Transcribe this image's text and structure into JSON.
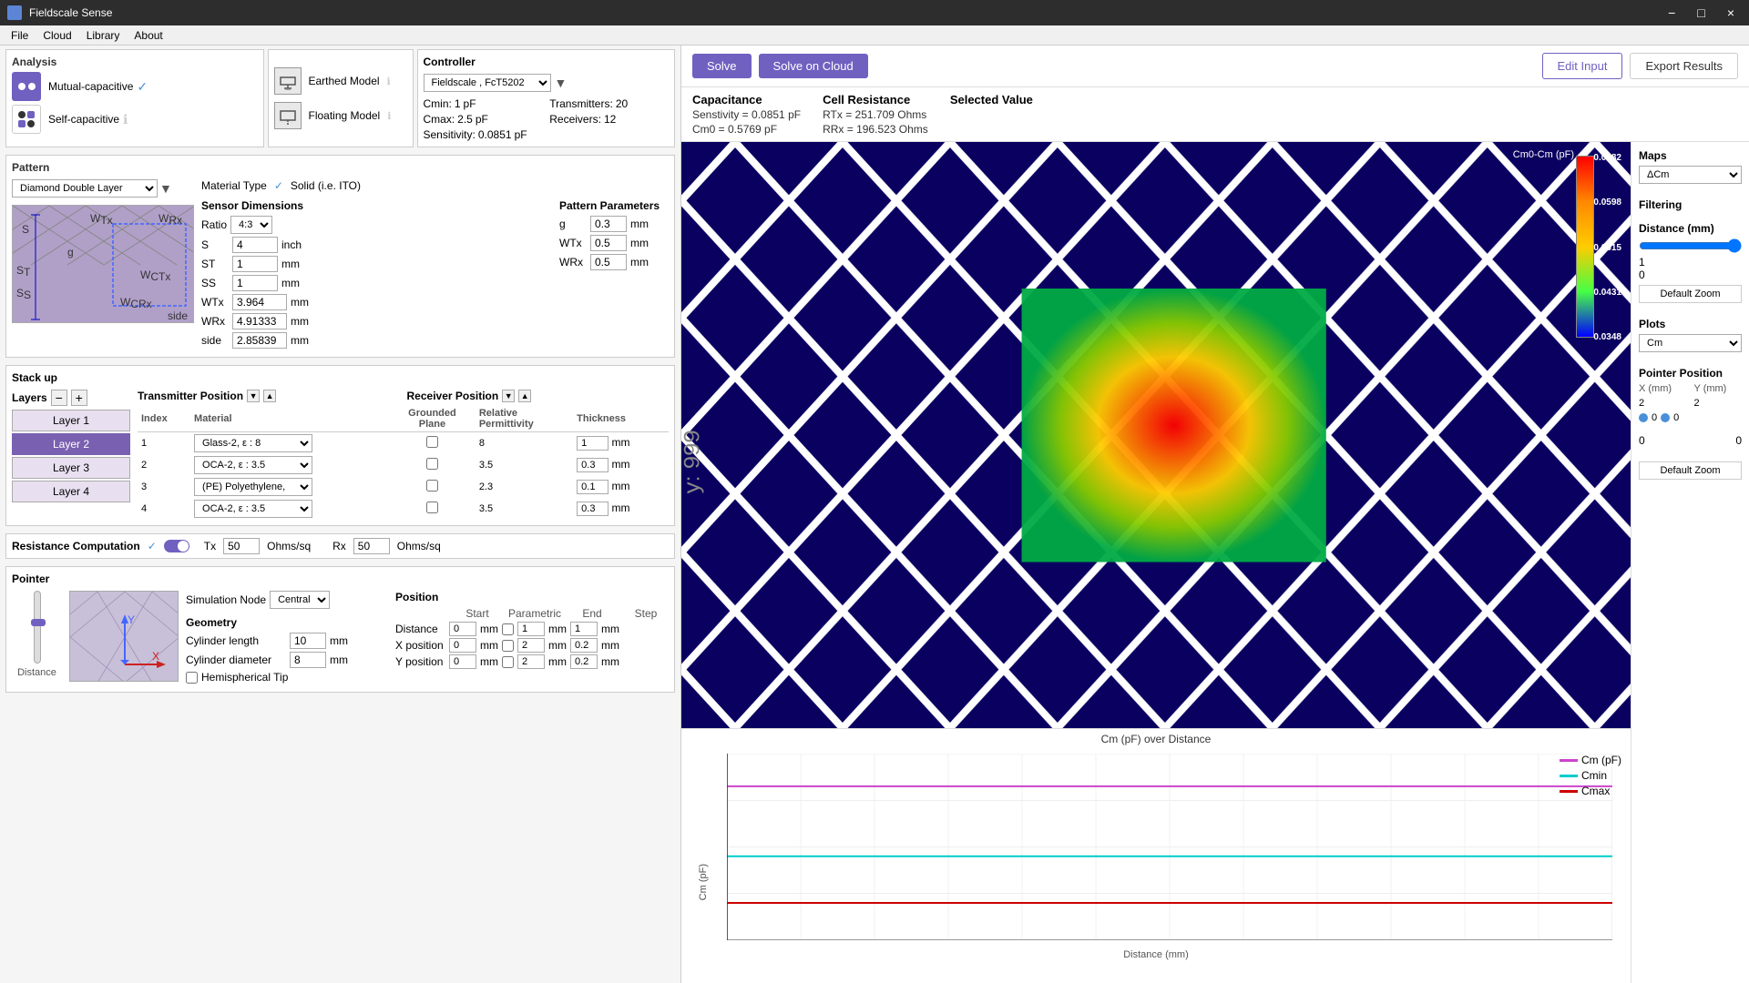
{
  "titleBar": {
    "appName": "Fieldscale Sense",
    "btnMinimize": "−",
    "btnMaximize": "□",
    "btnClose": "×"
  },
  "menuBar": {
    "items": [
      "File",
      "Cloud",
      "Library",
      "About"
    ]
  },
  "toolbar": {
    "solveLabel": "Solve",
    "solveCloudLabel": "Solve on Cloud",
    "editInputLabel": "Edit Input",
    "exportResultsLabel": "Export Results"
  },
  "infoBar": {
    "capacitanceTitle": "Capacitance",
    "capacitanceLine1": "Senstivity = 0.0851 pF",
    "capacitanceLine2": "Cm0 = 0.5769 pF",
    "cellResistanceTitle": "Cell Resistance",
    "cellResLine1": "RTx = 251.709 Ohms",
    "cellResLine2": "RRx = 196.523 Ohms",
    "selectedValueTitle": "Selected Value"
  },
  "analysis": {
    "title": "Analysis",
    "mutualCapLabel": "Mutual-capacitive",
    "selfCapLabel": "Self-capacitive",
    "earthedModelLabel": "Earthed Model",
    "floatingModelLabel": "Floating Model"
  },
  "controller": {
    "title": "Controller",
    "dropdown": "Fieldscale , FcT5202",
    "cminLabel": "Cmin:",
    "cminValue": "1",
    "cminUnit": "pF",
    "cmaxLabel": "Cmax:",
    "cmaxValue": "2.5",
    "cmaxUnit": "pF",
    "sensitivityLabel": "Sensitivity:",
    "sensitivityValue": "0.0851",
    "sensitivityUnit": "pF",
    "transmittersLabel": "Transmitters:",
    "transmittersValue": "20",
    "receiversLabel": "Receivers:",
    "receiversValue": "12"
  },
  "pattern": {
    "title": "Pattern",
    "dropdown": "Diamond Double Layer",
    "materialTypeLabel": "Material Type",
    "solidLabel": "Solid (i.e. ITO)",
    "sensorDimensionsTitle": "Sensor Dimensions",
    "ratioLabel": "Ratio",
    "ratioValue": "4:3",
    "sLabel": "S",
    "sValue": "4",
    "sUnit": "inch",
    "stLabel": "ST",
    "stValue": "1",
    "stUnit": "mm",
    "ssLabel": "SS",
    "ssValue": "1",
    "ssUnit": "mm",
    "wtxLabel": "WTx",
    "wtxValue": "3.964",
    "wtxUnit": "mm",
    "wrxLabel": "WRx",
    "wrxValue": "4.91333",
    "wrxUnit": "mm",
    "sideLabel": "side",
    "sideValue": "2.85839",
    "sideUnit": "mm",
    "patternParamsTitle": "Pattern Parameters",
    "gLabel": "g",
    "gValue": "0.3",
    "gUnit": "mm",
    "wtxParamLabel": "WTx",
    "wtxParamValue": "0.5",
    "wtxParamUnit": "mm",
    "wrxParamLabel": "WRx",
    "wrxParamValue": "0.5",
    "wrxParamUnit": "mm"
  },
  "stackup": {
    "title": "Stack up",
    "layersLabel": "Layers",
    "layers": [
      {
        "name": "Layer 1",
        "selected": false
      },
      {
        "name": "Layer 2",
        "selected": true
      },
      {
        "name": "Layer 3",
        "selected": false
      },
      {
        "name": "Layer 4",
        "selected": false
      }
    ],
    "transmitterPositionLabel": "Transmitter Position",
    "receiverPositionLabel": "Receiver Position",
    "groundedPlaneLabel": "Grounded Plane",
    "columns": [
      "Index",
      "Material",
      "Grounded Plane",
      "Relative Permittivity",
      "Thickness"
    ],
    "rows": [
      {
        "index": "1",
        "material": "Glass-2,  ε : 8",
        "groundedPlane": false,
        "permittivity": "8",
        "thickness": "1",
        "thicknessUnit": "mm"
      },
      {
        "index": "2",
        "material": "OCA-2,  ε : 3.5",
        "groundedPlane": false,
        "permittivity": "3.5",
        "thickness": "0.3",
        "thicknessUnit": "mm"
      },
      {
        "index": "3",
        "material": "(PE) Polyethylene,",
        "groundedPlane": false,
        "permittivity": "2.3",
        "thickness": "0.1",
        "thicknessUnit": "mm"
      },
      {
        "index": "4",
        "material": "OCA-2,  ε : 3.5",
        "groundedPlane": false,
        "permittivity": "3.5",
        "thickness": "0.3",
        "thicknessUnit": "mm"
      }
    ]
  },
  "resistance": {
    "title": "Resistance Computation",
    "enabled": true,
    "txLabel": "Tx",
    "txValue": "50",
    "txUnit": "Ohms/sq",
    "rxLabel": "Rx",
    "rxValue": "50",
    "rxUnit": "Ohms/sq"
  },
  "pointer": {
    "title": "Pointer",
    "simulationNodeLabel": "Simulation Node",
    "simulationNodeValue": "Central",
    "distanceLabel": "Distance",
    "geometry": {
      "title": "Geometry",
      "cylinderLengthLabel": "Cylinder length",
      "cylinderLengthValue": "10",
      "cylinderLengthUnit": "mm",
      "cylinderDiameterLabel": "Cylinder diameter",
      "cylinderDiameterValue": "8",
      "cylinderDiameterUnit": "mm",
      "hemisphericalTipLabel": "Hemispherical Tip"
    },
    "position": {
      "title": "Position",
      "headers": [
        "Start",
        "Parametric",
        "End",
        "Step"
      ],
      "distanceRow": {
        "label": "Distance",
        "start": "0",
        "startUnit": "mm",
        "end": "1",
        "endUnit": "mm",
        "step": "1",
        "stepUnit": "mm"
      },
      "xPosRow": {
        "label": "X position",
        "start": "0",
        "startUnit": "mm",
        "end": "2",
        "endUnit": "mm",
        "step": "0.2",
        "stepUnit": "mm"
      },
      "yPosRow": {
        "label": "Y position",
        "start": "0",
        "startUnit": "mm",
        "end": "2",
        "endUnit": "mm",
        "step": "0.2",
        "stepUnit": "mm"
      }
    }
  },
  "visualization": {
    "mapTitle": "ΔCm",
    "filteringLabel": "Filtering",
    "distanceLabel": "Distance (mm)",
    "distanceValue": "1",
    "distanceMin": "0",
    "colorScaleMax": "0.0682",
    "colorScaleVal1": "0.0598",
    "colorScaleVal2": "0.0515",
    "colorScaleVal3": "0.0431",
    "colorScaleVal4": "0.0348",
    "yAxisLabel": "y: 999",
    "plotsLabel": "Plots",
    "plotsValue": "Cm",
    "pointerPosLabel": "Pointer Position",
    "pointerPosXLabel": "X (mm)",
    "pointerPosYLabel": "Y (mm)",
    "pointerPosXValue": "2",
    "pointerPosYValue": "2",
    "defaultZoom1": "Default Zoom",
    "defaultZoom2": "Default Zoom"
  },
  "chart": {
    "title": "Cm (pF) over Distance",
    "xAxisLabel": "Distance (mm)",
    "yAxisLabel": "Cm (pF)",
    "xMin": "-0.1",
    "xMax": "1.1",
    "yMin": "0.5",
    "yMax": "2.5",
    "legend": [
      {
        "label": "Cm (pF)",
        "color": "#cc44cc"
      },
      {
        "label": "Cmin",
        "color": "#00cccc"
      },
      {
        "label": "Cmax",
        "color": "#cc0000"
      }
    ],
    "gridLines": [
      "0",
      "0.1",
      "0.2",
      "0.3",
      "0.4",
      "0.5",
      "0.6",
      "0.7",
      "0.8",
      "0.9",
      "1",
      "1.1"
    ]
  }
}
